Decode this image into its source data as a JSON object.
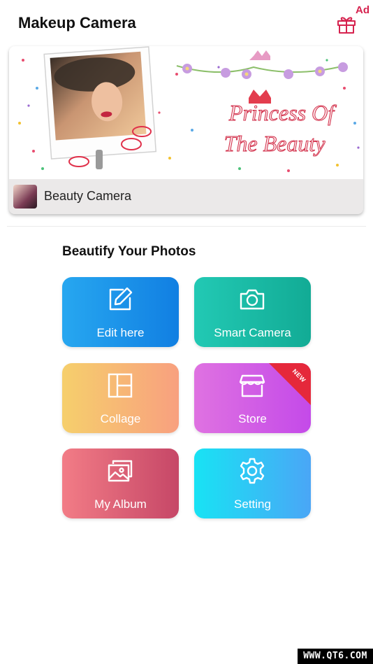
{
  "header": {
    "title": "Makeup Camera",
    "ad_label": "Ad",
    "gift_icon": "gift-icon"
  },
  "banner": {
    "script_line1": "Princess Of",
    "script_line2": "The Beauty",
    "footer_label": "Beauty Camera"
  },
  "section": {
    "title": "Beautify Your Photos"
  },
  "tiles": [
    {
      "label": "Edit here",
      "icon": "edit-icon"
    },
    {
      "label": "Smart Camera",
      "icon": "camera-icon"
    },
    {
      "label": "Collage",
      "icon": "collage-icon"
    },
    {
      "label": "Store",
      "icon": "store-icon",
      "badge": "NEW"
    },
    {
      "label": "My Album",
      "icon": "album-icon"
    },
    {
      "label": "Setting",
      "icon": "settings-icon"
    }
  ],
  "watermark": "WWW.QT6.COM",
  "colors": {
    "ad": "#d6234f",
    "edit": "#1a8fe8",
    "camera": "#1abba5",
    "collage": "#f7b877",
    "store": "#d25fe5",
    "album": "#dd5f76",
    "setting": "#30c6f5",
    "badge": "#e5283b"
  }
}
